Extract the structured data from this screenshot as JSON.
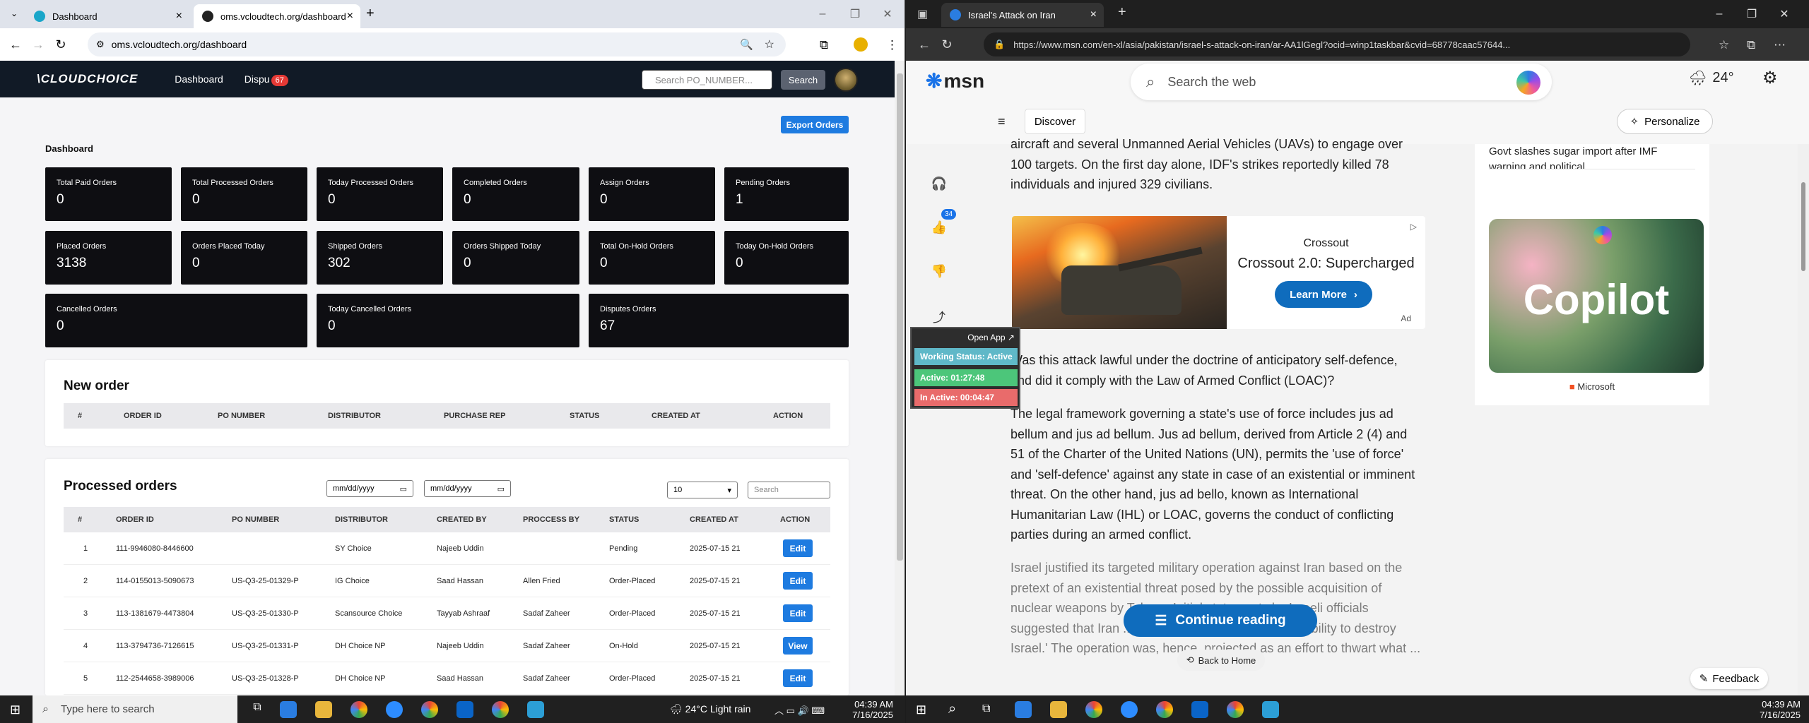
{
  "left_browser": {
    "tabs": [
      {
        "title": "Dashboard"
      },
      {
        "title": "oms.vcloudtech.org/dashboard"
      }
    ],
    "new_tab": "+",
    "url": "oms.vcloudtech.org/dashboard"
  },
  "oms": {
    "logo": "\\CLOUDCHOICE",
    "nav": {
      "dashboard": "Dashboard",
      "disputes": "Dispu",
      "disputes_badge": "67"
    },
    "search": {
      "placeholder": "Search PO_NUMBER...",
      "button": "Search"
    },
    "export_button": "Export Orders",
    "dashboard_title": "Dashboard",
    "cards": [
      {
        "label": "Total Paid Orders",
        "value": "0"
      },
      {
        "label": "Total Processed Orders",
        "value": "0"
      },
      {
        "label": "Today Processed Orders",
        "value": "0"
      },
      {
        "label": "Completed Orders",
        "value": "0"
      },
      {
        "label": "Assign Orders",
        "value": "0"
      },
      {
        "label": "Pending Orders",
        "value": "1"
      },
      {
        "label": "Placed Orders",
        "value": "3138"
      },
      {
        "label": "Orders Placed Today",
        "value": "0"
      },
      {
        "label": "Shipped Orders",
        "value": "302"
      },
      {
        "label": "Orders Shipped Today",
        "value": "0"
      },
      {
        "label": "Total On-Hold Orders",
        "value": "0"
      },
      {
        "label": "Today On-Hold Orders",
        "value": "0"
      },
      {
        "label": "Cancelled Orders",
        "value": "0"
      },
      {
        "label": "Today Cancelled Orders",
        "value": "0"
      },
      {
        "label": "Disputes Orders",
        "value": "67"
      }
    ],
    "new_order": {
      "title": "New order",
      "columns": [
        "#",
        "ORDER ID",
        "PO NUMBER",
        "DISTRIBUTOR",
        "PURCHASE REP",
        "STATUS",
        "CREATED AT",
        "ACTION"
      ]
    },
    "processed": {
      "title": "Processed orders",
      "date_from": "mm/dd/yyyy",
      "date_to": "mm/dd/yyyy",
      "page_size": "10",
      "search_placeholder": "Search",
      "columns": [
        "#",
        "ORDER ID",
        "PO NUMBER",
        "DISTRIBUTOR",
        "CREATED BY",
        "PROCCESS BY",
        "STATUS",
        "CREATED AT",
        "ACTION"
      ],
      "rows": [
        {
          "n": "1",
          "order_id": "111-9946080-8446600",
          "po": "",
          "distributor": "SY Choice",
          "created_by": "Najeeb Uddin",
          "process_by": "",
          "status": "Pending",
          "created_at": "2025-07-15 21",
          "action": "Edit"
        },
        {
          "n": "2",
          "order_id": "114-0155013-5090673",
          "po": "US-Q3-25-01329-P",
          "distributor": "IG Choice",
          "created_by": "Saad Hassan",
          "process_by": "Allen Fried",
          "status": "Order-Placed",
          "created_at": "2025-07-15 21",
          "action": "Edit"
        },
        {
          "n": "3",
          "order_id": "113-1381679-4473804",
          "po": "US-Q3-25-01330-P",
          "distributor": "Scansource Choice",
          "created_by": "Tayyab Ashraaf",
          "process_by": "Sadaf Zaheer",
          "status": "Order-Placed",
          "created_at": "2025-07-15 21",
          "action": "Edit"
        },
        {
          "n": "4",
          "order_id": "113-3794736-7126615",
          "po": "US-Q3-25-01331-P",
          "distributor": "DH Choice NP",
          "created_by": "Najeeb Uddin",
          "process_by": "Sadaf Zaheer",
          "status": "On-Hold",
          "created_at": "2025-07-15 21",
          "action": "View"
        },
        {
          "n": "5",
          "order_id": "112-2544658-3989006",
          "po": "US-Q3-25-01328-P",
          "distributor": "DH Choice NP",
          "created_by": "Saad Hassan",
          "process_by": "Sadaf Zaheer",
          "status": "Order-Placed",
          "created_at": "2025-07-15 21",
          "action": "Edit"
        }
      ]
    }
  },
  "right_browser": {
    "tab_title": "Israel's Attack on Iran",
    "url": "https://www.msn.com/en-xl/asia/pakistan/israel-s-attack-on-iran/ar-AA1lGegl?ocid=winp1taskbar&cvid=68778caac57644...",
    "new_tab": "+"
  },
  "msn": {
    "logo": "msn",
    "search_placeholder": "Search the web",
    "weather": "24°",
    "discover": "Discover",
    "personalize": "Personalize",
    "article_p1": "aircraft and several Unmanned Aerial Vehicles (UAVs) to engage over 100 targets. On the first day alone, IDF's strikes reportedly killed 78 individuals and injured 329 civilians.",
    "ad": {
      "brand": "Crossout",
      "title": "Crossout 2.0: Supercharged",
      "cta": "Learn More",
      "tag": "Ad"
    },
    "article_p2": "Was this attack lawful under the doctrine of anticipatory self-defence, and did it comply with the Law of Armed Conflict (LOAC)?",
    "article_p3": "The legal framework governing a state's use of force includes jus ad bellum and jus ad bellum. Jus ad bellum, derived from Article 2 (4) and 51 of the Charter of the United Nations (UN), permits the 'use of force' and 'self-defence' against any state in case of an existential or imminent threat. On the other hand, jus ad bello, known as International Humanitarian Law (IHL) or LOAC, governs the conduct of conflicting parties during an armed conflict.",
    "article_p4": "Israel justified its targeted military operation against Iran based on the pretext of an existential threat posed by the possible acquisition of nuclear weapons by Tehran. Initial statements by Israeli officials suggested that Iran ... nuclear programme, with the 'ability to destroy Israel.' The operation was, hence, projected as an effort to thwart what ...",
    "like_count": "34",
    "continue_reading": "Continue reading",
    "back_home": "Back to Home",
    "feedback": "Feedback",
    "side_news": "Govt slashes sugar import after IMF warning and political...",
    "copilot_word": "Copilot",
    "microsoft": "Microsoft"
  },
  "tracker": {
    "open_app": "Open App ↗",
    "working_status": "Working Status: Active",
    "active_time": "Active: 01:27:48",
    "inactive_time": "In Active: 00:04:47"
  },
  "taskbar_left": {
    "search_placeholder": "Type here to search",
    "weather": "24°C  Light rain",
    "time": "04:39 AM",
    "date": "7/16/2025"
  },
  "taskbar_right": {
    "time": "04:39 AM",
    "date": "7/16/2025"
  }
}
